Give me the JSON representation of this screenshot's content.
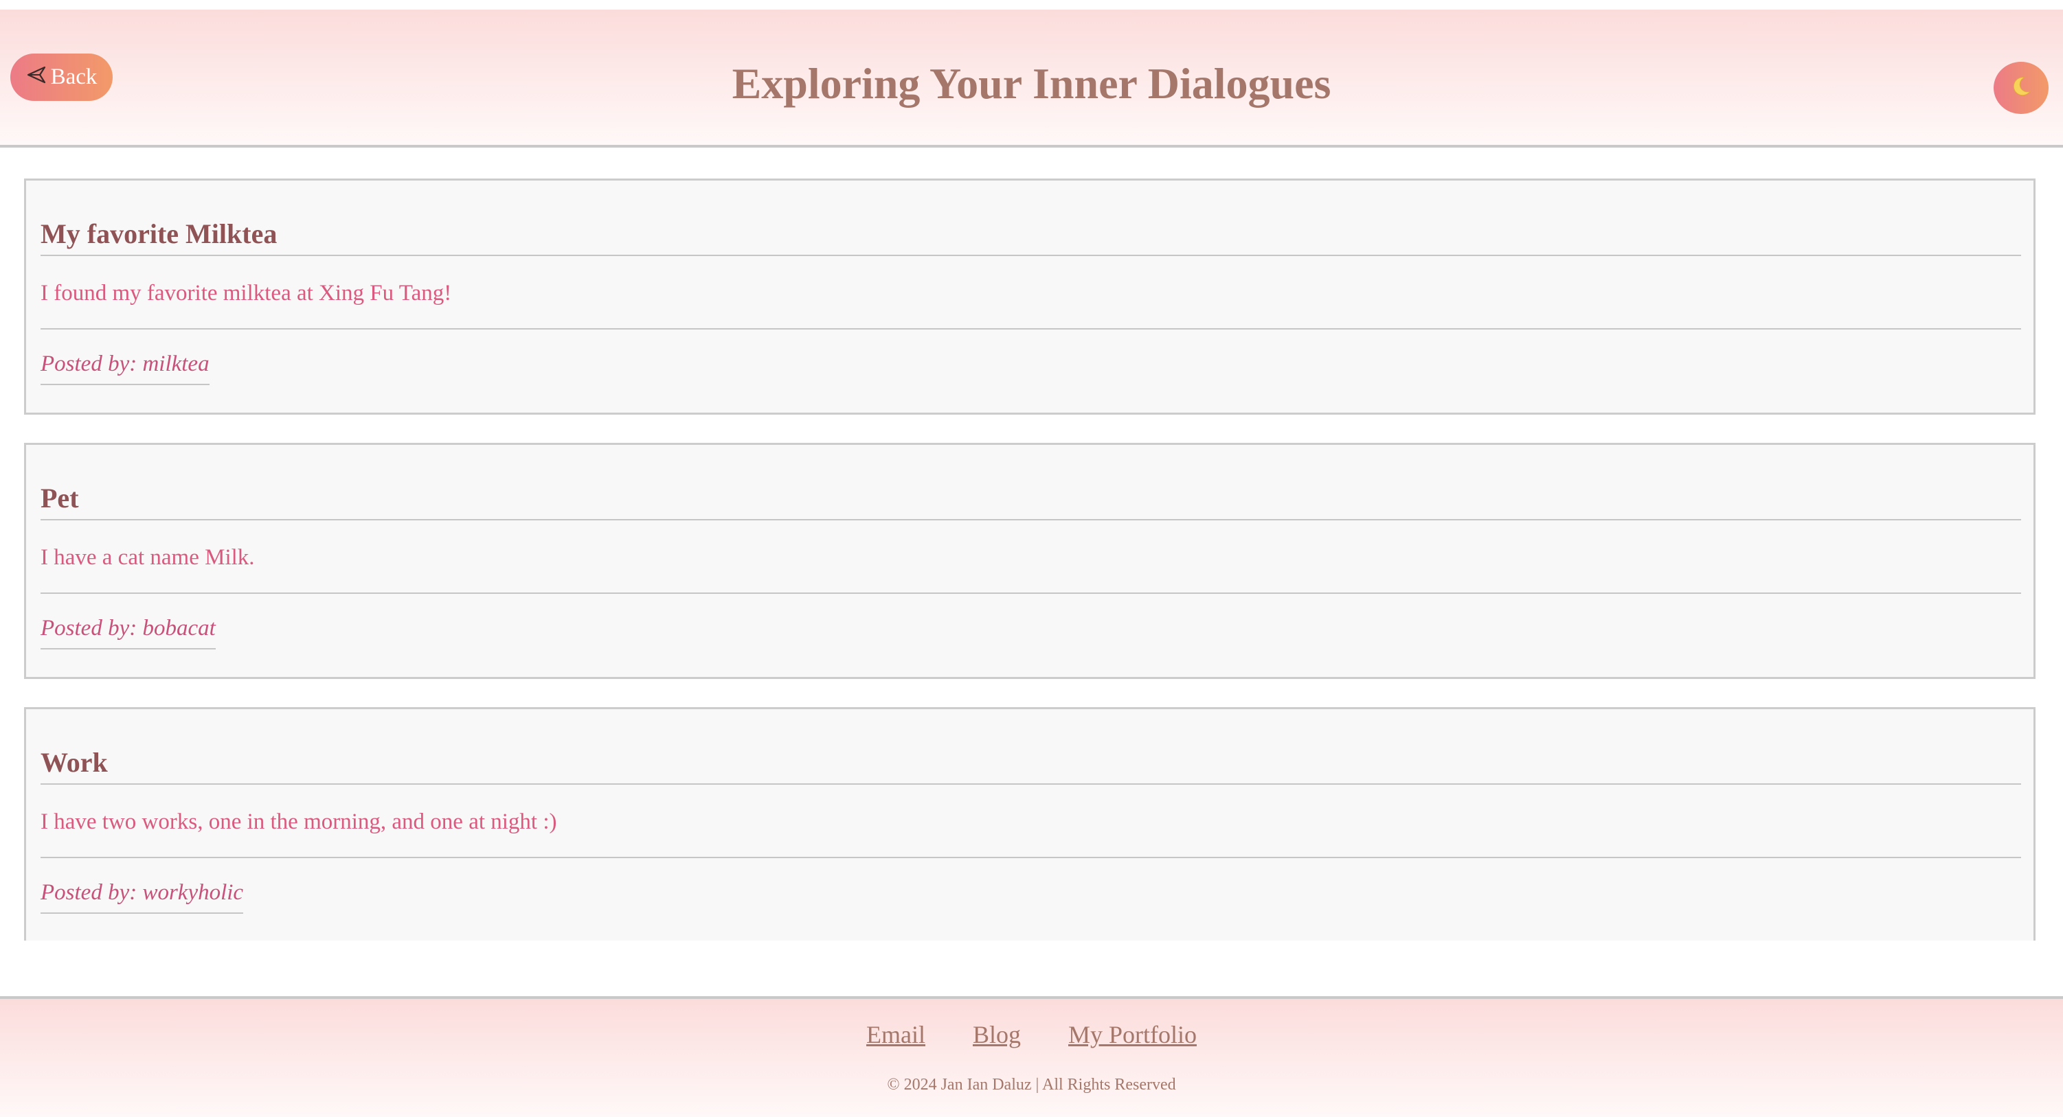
{
  "header": {
    "back_label": "Back",
    "back_icon": "send-arrow-icon",
    "title": "Exploring Your Inner Dialogues",
    "theme_toggle_icon": "moon-icon"
  },
  "posts": [
    {
      "title": "My favorite Milktea",
      "body": "I found my favorite milktea at Xing Fu Tang!",
      "author": "Posted by: milktea"
    },
    {
      "title": "Pet",
      "body": "I have a cat name Milk.",
      "author": "Posted by: bobacat"
    },
    {
      "title": "Work",
      "body": "I have two works, one in the morning, and one at night :)",
      "author": "Posted by: workyholic"
    }
  ],
  "footer": {
    "links": [
      "Email",
      "Blog",
      "My Portfolio"
    ],
    "copyright": "© 2024 Jan Ian Daluz | All Rights Reserved"
  },
  "colors": {
    "accent_gradient_start": "#ec7b86",
    "accent_gradient_end": "#f29a69",
    "title_color": "#a4776a",
    "post_title_color": "#8f5356",
    "post_body_color": "#d95a7e"
  }
}
